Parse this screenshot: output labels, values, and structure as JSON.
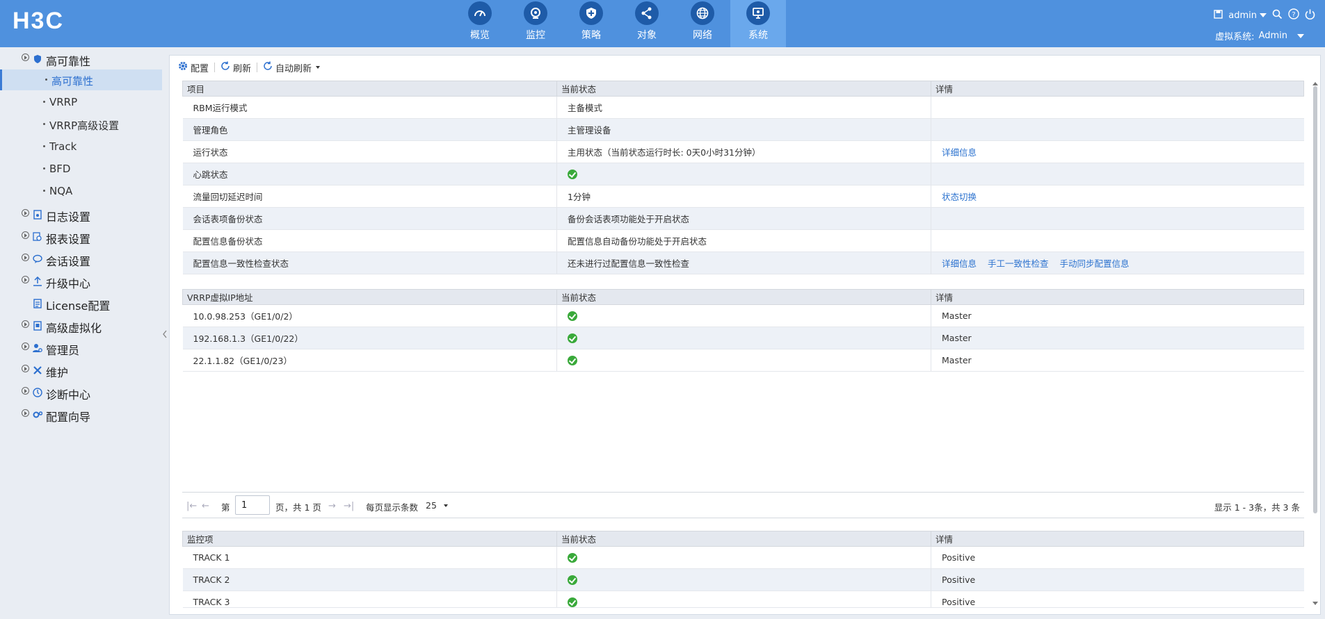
{
  "header": {
    "logo": "H3C",
    "nav": [
      {
        "label": "概览",
        "icon": "speedometer-icon"
      },
      {
        "label": "监控",
        "icon": "camera-icon"
      },
      {
        "label": "策略",
        "icon": "shield-plus-icon"
      },
      {
        "label": "对象",
        "icon": "share-icon"
      },
      {
        "label": "网络",
        "icon": "globe-icon"
      },
      {
        "label": "系统",
        "icon": "monitor-icon"
      }
    ],
    "active_nav": "系统",
    "user": "admin",
    "vsys_label": "虚拟系统:",
    "vsys_value": "Admin"
  },
  "sidebar": {
    "ha_group": "高可靠性",
    "ha_items": [
      "高可靠性",
      "VRRP",
      "VRRP高级设置",
      "Track",
      "BFD",
      "NQA"
    ],
    "groups": [
      "日志设置",
      "报表设置",
      "会话设置",
      "升级中心",
      "License配置",
      "高级虚拟化",
      "管理员",
      "维护",
      "诊断中心",
      "配置向导"
    ]
  },
  "toolbar": {
    "config": "配置",
    "refresh": "刷新",
    "auto_refresh": "自动刷新"
  },
  "table1": {
    "headers": [
      "项目",
      "当前状态",
      "详情"
    ],
    "rows": [
      {
        "item": "RBM运行模式",
        "status": "主备模式",
        "links": []
      },
      {
        "item": "管理角色",
        "status": "主管理设备",
        "links": []
      },
      {
        "item": "运行状态",
        "status": "主用状态（当前状态运行时长: 0天0小时31分钟）",
        "links": [
          "详细信息"
        ]
      },
      {
        "item": "心跳状态",
        "status": "",
        "links": []
      },
      {
        "item": "流量回切延迟时间",
        "status": "1分钟",
        "links": [
          "状态切换"
        ]
      },
      {
        "item": "会话表项备份状态",
        "status": "备份会话表项功能处于开启状态",
        "links": []
      },
      {
        "item": "配置信息备份状态",
        "status": "配置信息自动备份功能处于开启状态",
        "links": []
      },
      {
        "item": "配置信息一致性检查状态",
        "status": "还未进行过配置信息一致性检查",
        "links": [
          "详细信息",
          "手工一致性检查",
          "手动同步配置信息"
        ]
      }
    ]
  },
  "table2": {
    "headers": [
      "VRRP虚拟IP地址",
      "当前状态",
      "详情"
    ],
    "rows": [
      {
        "ip": "10.0.98.253（GE1/0/2）",
        "detail": "Master"
      },
      {
        "ip": "192.168.1.3（GE1/0/22）",
        "detail": "Master"
      },
      {
        "ip": "22.1.1.82（GE1/0/23）",
        "detail": "Master"
      }
    ]
  },
  "pager": {
    "prefix": "第",
    "page": "1",
    "of_text": "页，共 1 页",
    "per_page_label": "每页显示条数",
    "per_page": "25",
    "summary": "显示 1 - 3条，共 3 条"
  },
  "table3": {
    "headers": [
      "监控项",
      "当前状态",
      "详情"
    ],
    "rows": [
      {
        "item": "TRACK 1",
        "detail": "Positive"
      },
      {
        "item": "TRACK 2",
        "detail": "Positive"
      },
      {
        "item": "TRACK 3",
        "detail": "Positive"
      }
    ]
  },
  "colors": {
    "header_bg": "#4f91de",
    "nav_active_bg": "#6aa8ec",
    "link": "#2d73cf",
    "ok_green": "#39a93a"
  }
}
